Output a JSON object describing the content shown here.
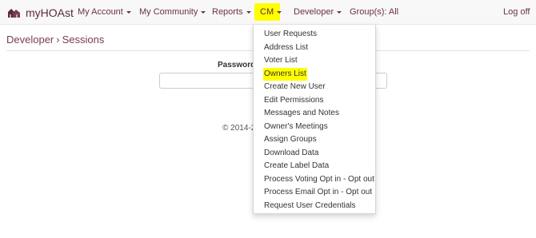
{
  "navbar": {
    "brand": "myHOAst",
    "items": [
      {
        "label": "My Account",
        "caret": true
      },
      {
        "label": "My Community",
        "caret": true
      },
      {
        "label": "Reports",
        "caret": true
      },
      {
        "label": "CM",
        "caret": true
      },
      {
        "label": "Developer",
        "caret": true
      },
      {
        "label": "Group(s): All",
        "caret": false
      },
      {
        "label": "Log off",
        "caret": false
      }
    ],
    "active_item": "CM"
  },
  "breadcrumb": {
    "parent": "Developer",
    "separator": "›",
    "current": "Sessions"
  },
  "form": {
    "password_label": "Password",
    "password_value": ""
  },
  "footer": {
    "text": "© 2014-2"
  },
  "cm_menu": {
    "items": [
      "User Requests",
      "Address List",
      "Voter List",
      "Owners List",
      "Create New User",
      "Edit Permissions",
      "Messages and Notes",
      "Owner's Meetings",
      "Assign Groups",
      "Download Data",
      "Create Label Data",
      "Process Voting Opt in - Opt out",
      "Process Email Opt in - Opt out",
      "Request User Credentials"
    ],
    "highlighted_item": "Owners List"
  },
  "colors": {
    "brand": "#5a2a3d",
    "highlight": "#ffff00"
  }
}
